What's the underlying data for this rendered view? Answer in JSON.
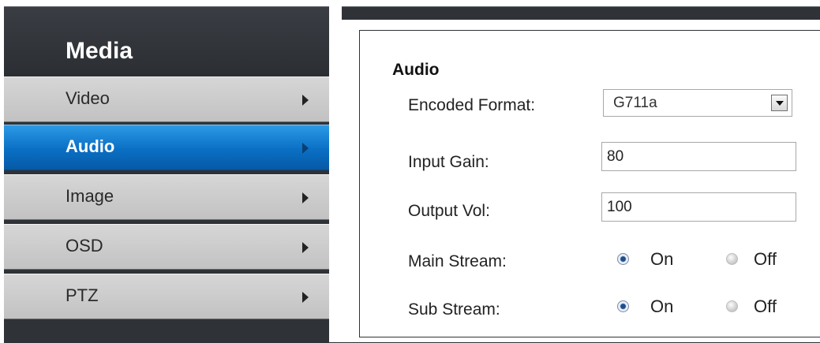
{
  "sidebar": {
    "title": "Media",
    "items": [
      {
        "label": "Video",
        "active": false
      },
      {
        "label": "Audio",
        "active": true
      },
      {
        "label": "Image",
        "active": false
      },
      {
        "label": "OSD",
        "active": false
      },
      {
        "label": "PTZ",
        "active": false
      }
    ]
  },
  "main": {
    "section_title": "Audio",
    "encoded_format": {
      "label": "Encoded Format:",
      "value": "G711a"
    },
    "input_gain": {
      "label": "Input Gain:",
      "value": "80"
    },
    "output_vol": {
      "label": "Output Vol:",
      "value": "100"
    },
    "main_stream": {
      "label": "Main Stream:",
      "on_label": "On",
      "off_label": "Off",
      "selected": "On"
    },
    "sub_stream": {
      "label": "Sub Stream:",
      "on_label": "On",
      "off_label": "Off",
      "selected": "On"
    }
  },
  "colors": {
    "accent": "#0a6fc4",
    "dark_bg": "#2f3237",
    "menu_gray": "#c9c9c9"
  }
}
